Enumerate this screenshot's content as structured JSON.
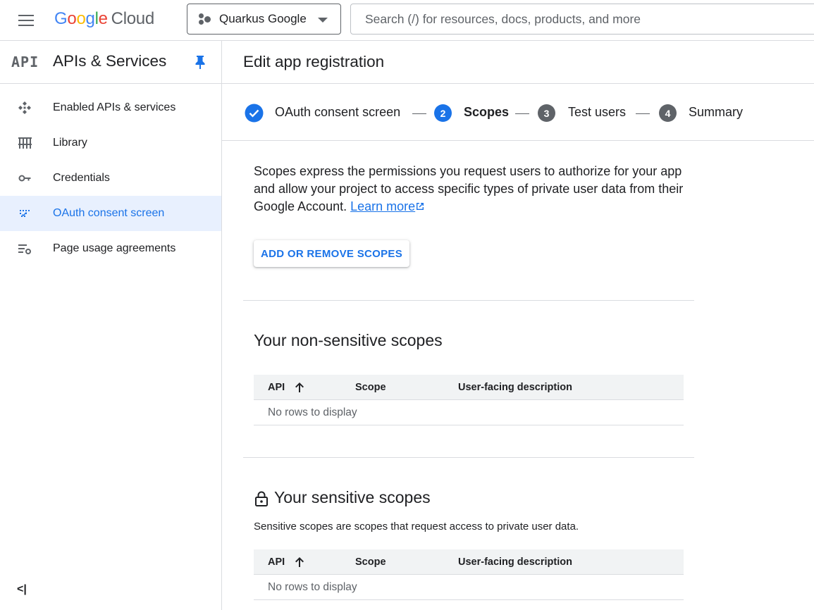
{
  "header": {
    "logo_google": "Google",
    "logo_cloud": "Cloud",
    "project_name": "Quarkus Google",
    "search_placeholder": "Search (/) for resources, docs, products, and more"
  },
  "sidebar": {
    "badge": "API",
    "title": "APIs & Services",
    "items": [
      {
        "label": "Enabled APIs & services",
        "icon": "enabled-apis-icon"
      },
      {
        "label": "Library",
        "icon": "library-icon"
      },
      {
        "label": "Credentials",
        "icon": "key-icon"
      },
      {
        "label": "OAuth consent screen",
        "icon": "oauth-icon",
        "active": true
      },
      {
        "label": "Page usage agreements",
        "icon": "settings-list-icon"
      }
    ],
    "collapse_label": "<|"
  },
  "main": {
    "title": "Edit app registration",
    "steps": [
      {
        "number": "",
        "label": "OAuth consent screen",
        "state": "done"
      },
      {
        "number": "2",
        "label": "Scopes",
        "state": "current"
      },
      {
        "number": "3",
        "label": "Test users",
        "state": "upcoming"
      },
      {
        "number": "4",
        "label": "Summary",
        "state": "upcoming"
      }
    ],
    "intro_text": "Scopes express the permissions you request users to authorize for your app and allow your project to access specific types of private user data from their Google Account.",
    "learn_more": "Learn more",
    "add_button": "ADD OR REMOVE SCOPES",
    "non_sensitive": {
      "title": "Your non-sensitive scopes",
      "columns": [
        "API",
        "Scope",
        "User-facing description"
      ],
      "empty": "No rows to display"
    },
    "sensitive": {
      "title": "Your sensitive scopes",
      "description": "Sensitive scopes are scopes that request access to private user data.",
      "columns": [
        "API",
        "Scope",
        "User-facing description"
      ],
      "empty": "No rows to display"
    }
  },
  "colors": {
    "accent": "#1a73e8",
    "active_bg": "#e8f0fe",
    "step_upcoming": "#5f6368"
  }
}
